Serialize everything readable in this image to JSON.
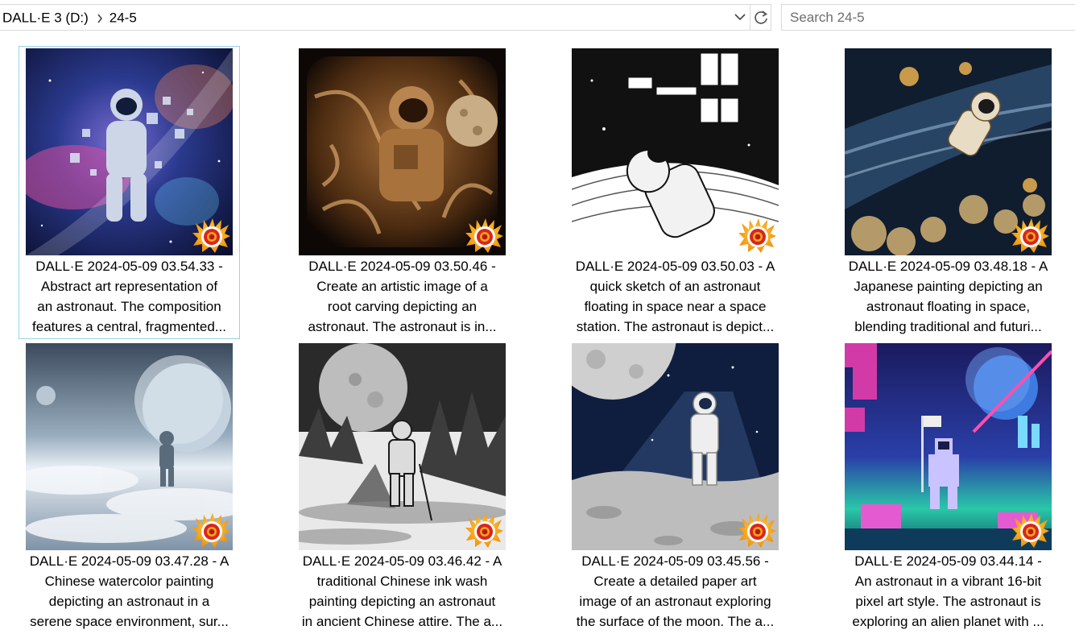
{
  "address_bar": {
    "crumbs": [
      "DALL·E 3 (D:)",
      "24-5"
    ],
    "dropdown_icon": "chevron-down-icon",
    "refresh_icon": "refresh-icon"
  },
  "search": {
    "placeholder": "Search 24-5"
  },
  "files": [
    {
      "caption": [
        "DALL·E 2024-05-09 03.54.33 -",
        "Abstract art representation of",
        "an astronaut. The composition",
        "features a central, fragmented..."
      ],
      "icon": "xnview-icon"
    },
    {
      "caption": [
        "DALL·E 2024-05-09 03.50.46 -",
        "Create an artistic image of a",
        "root carving depicting an",
        "astronaut. The astronaut is in..."
      ],
      "icon": "xnview-icon"
    },
    {
      "caption": [
        "DALL·E 2024-05-09 03.50.03 - A",
        "quick sketch of an astronaut",
        "floating in space near a space",
        "station. The astronaut is depict..."
      ],
      "icon": "xnview-icon"
    },
    {
      "caption": [
        "DALL·E 2024-05-09 03.48.18 - A",
        "Japanese painting depicting an",
        "astronaut floating in space,",
        "blending traditional and futuri..."
      ],
      "icon": "xnview-icon"
    },
    {
      "caption": [
        "DALL·E 2024-05-09 03.47.28 - A",
        "Chinese watercolor painting",
        "depicting an astronaut in a",
        "serene space environment, sur..."
      ],
      "icon": "xnview-icon"
    },
    {
      "caption": [
        "DALL·E 2024-05-09 03.46.42 - A",
        "traditional Chinese ink wash",
        "painting depicting an astronaut",
        "in ancient Chinese attire. The a..."
      ],
      "icon": "xnview-icon"
    },
    {
      "caption": [
        "DALL·E 2024-05-09 03.45.56 -",
        "Create a detailed paper art",
        "image of an astronaut exploring",
        "the surface of the moon. The a..."
      ],
      "icon": "xnview-icon"
    },
    {
      "caption": [
        "DALL·E 2024-05-09 03.44.14 -",
        "An astronaut in a vibrant 16-bit",
        "pixel art style. The astronaut is",
        "exploring an alien planet with ..."
      ],
      "icon": "xnview-icon"
    }
  ],
  "selected_index": 0,
  "colors": {
    "selection_border": "#99d1e7",
    "badge_orange": "#f7931e",
    "badge_red": "#d9261c"
  }
}
